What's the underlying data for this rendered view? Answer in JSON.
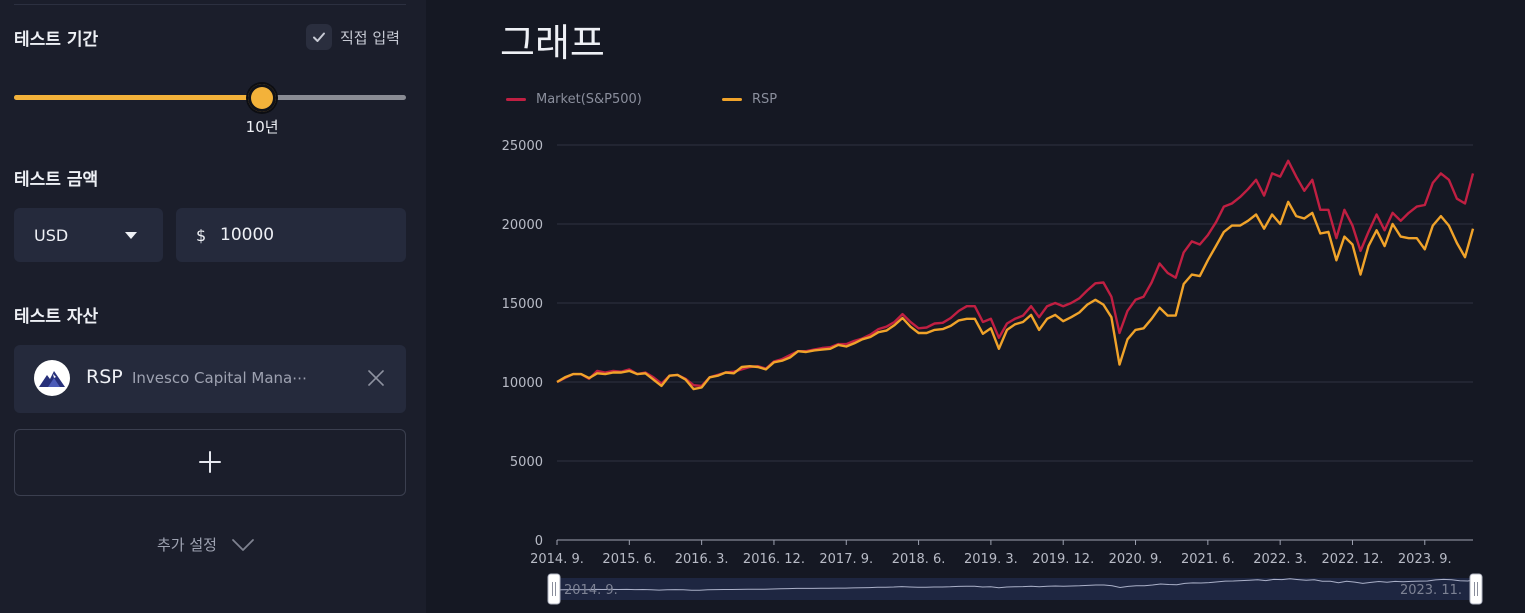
{
  "sidebar": {
    "period": {
      "title": "테스트 기간",
      "direct_input_label": "직접 입력",
      "direct_input_checked": true,
      "slider_value_label": "10년",
      "slider_fraction": 0.633
    },
    "amount": {
      "title": "테스트 금액",
      "currency": "USD",
      "currency_symbol": "$",
      "value": "10000"
    },
    "assets": {
      "title": "테스트 자산",
      "items": [
        {
          "ticker": "RSP",
          "name": "Invesco Capital Mana⋯",
          "logo_icon": "invesco-mountain-logo"
        }
      ],
      "add_icon": "plus-icon"
    },
    "more_settings": {
      "label": "추가 설정",
      "icon": "chevron-down-icon"
    }
  },
  "main": {
    "title": "그래프"
  },
  "colors": {
    "accent": "#f3b23a",
    "market_series": "#c01f42",
    "rsp_series": "#f0a32a",
    "background": "#151823",
    "sidebar": "#1b1e2b",
    "field": "#252a3c"
  },
  "chart_data": {
    "type": "line",
    "legend_position": "top-left",
    "grid": true,
    "ylim": [
      0,
      25000
    ],
    "y_ticks": [
      "0",
      "5000",
      "10000",
      "15000",
      "20000",
      "25000"
    ],
    "x_tick_labels": [
      "2014. 9.",
      "2015. 6.",
      "2016. 3.",
      "2016. 12.",
      "2017. 9.",
      "2018. 6.",
      "2019. 3.",
      "2019. 12.",
      "2020. 9.",
      "2021. 6.",
      "2022. 3.",
      "2022. 12.",
      "2023. 9."
    ],
    "x_start": "2014-09",
    "x_end": "2023-11",
    "series": [
      {
        "name": "Market(S&P500)",
        "color": "#c01f42",
        "values": [
          10000,
          10250,
          10500,
          10500,
          10200,
          10700,
          10600,
          10700,
          10650,
          10800,
          10500,
          10600,
          10300,
          9900,
          10400,
          10450,
          10200,
          9800,
          9750,
          10300,
          10450,
          10600,
          10650,
          10800,
          10950,
          11000,
          10850,
          11300,
          11450,
          11700,
          11950,
          11950,
          12050,
          12150,
          12200,
          12400,
          12400,
          12600,
          12750,
          13000,
          13350,
          13500,
          13800,
          14300,
          13800,
          13400,
          13450,
          13700,
          13750,
          14050,
          14500,
          14800,
          14800,
          13800,
          14000,
          12800,
          13700,
          14000,
          14200,
          14800,
          14100,
          14800,
          15000,
          14800,
          15000,
          15300,
          15800,
          16250,
          16300,
          15400,
          13100,
          14500,
          15200,
          15400,
          16300,
          17500,
          16900,
          16600,
          18200,
          18900,
          18700,
          19300,
          20100,
          21100,
          21300,
          21700,
          22200,
          22800,
          21800,
          23200,
          23000,
          24000,
          23000,
          22100,
          22800,
          20900,
          20900,
          19100,
          20900,
          19900,
          18300,
          19500,
          20600,
          19600,
          20700,
          20200,
          20700,
          21100,
          21200,
          22600,
          23200,
          22800,
          21600,
          21300,
          23200
        ]
      },
      {
        "name": "RSP",
        "color": "#f0a32a",
        "values": [
          10000,
          10300,
          10500,
          10500,
          10250,
          10550,
          10500,
          10600,
          10600,
          10700,
          10500,
          10550,
          10150,
          9750,
          10400,
          10450,
          10150,
          9550,
          9650,
          10300,
          10400,
          10600,
          10550,
          10950,
          11000,
          10950,
          10800,
          11250,
          11350,
          11550,
          11950,
          11900,
          12000,
          12050,
          12100,
          12350,
          12250,
          12450,
          12700,
          12850,
          13150,
          13250,
          13600,
          14050,
          13500,
          13100,
          13100,
          13300,
          13350,
          13550,
          13900,
          14000,
          14000,
          13050,
          13400,
          12100,
          13300,
          13650,
          13800,
          14250,
          13300,
          14000,
          14250,
          13850,
          14100,
          14400,
          14900,
          15200,
          14900,
          14100,
          11100,
          12700,
          13300,
          13400,
          14000,
          14700,
          14200,
          14200,
          16200,
          16800,
          16700,
          17700,
          18600,
          19500,
          19900,
          19900,
          20200,
          20600,
          19700,
          20600,
          20000,
          21400,
          20500,
          20350,
          20700,
          19400,
          19500,
          17700,
          19200,
          18700,
          16800,
          18600,
          19600,
          18600,
          20000,
          19200,
          19100,
          19100,
          18400,
          19900,
          20500,
          19900,
          18800,
          17900,
          19700
        ]
      }
    ],
    "brush": {
      "start_label": "2014. 9.",
      "end_label": "2023. 11."
    }
  }
}
